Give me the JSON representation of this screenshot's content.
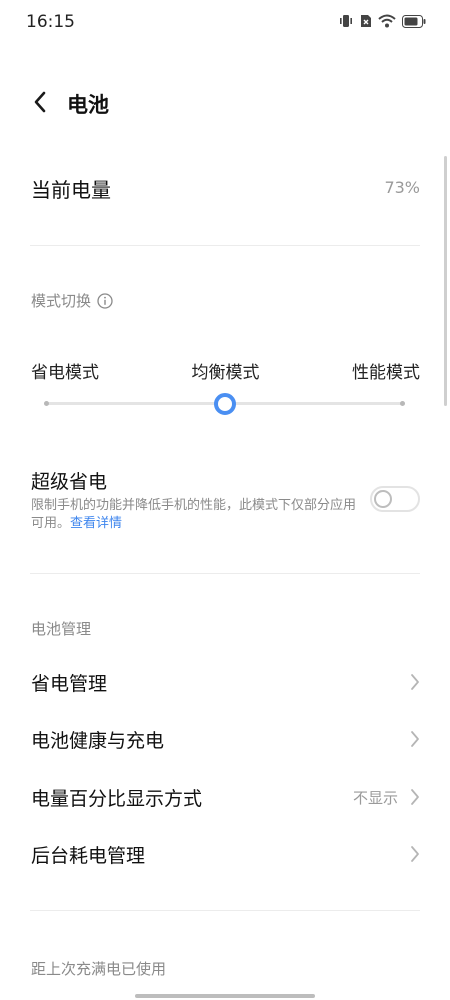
{
  "status_bar": {
    "time": "16:15",
    "icons": [
      "vibrate-icon",
      "no-sim-icon",
      "wifi-icon",
      "battery-icon"
    ]
  },
  "header": {
    "title": "电池",
    "back_icon": "back-arrow-icon"
  },
  "current_level": {
    "label": "当前电量",
    "value": "73%"
  },
  "mode_switch": {
    "section_label": "模式切换",
    "info_icon": "info-icon",
    "options": [
      "省电模式",
      "均衡模式",
      "性能模式"
    ],
    "selected_index": 1,
    "accent_color": "#4a8ff2"
  },
  "super_saver": {
    "title": "超级省电",
    "description": "限制手机的功能并降低手机的性能，此模式下仅部分应用可用。",
    "link_text": "查看详情",
    "enabled": false,
    "link_color": "#3f86ee"
  },
  "battery_management": {
    "section_label": "电池管理",
    "items": [
      {
        "label": "省电管理",
        "value": ""
      },
      {
        "label": "电池健康与充电",
        "value": ""
      },
      {
        "label": "电量百分比显示方式",
        "value": "不显示"
      },
      {
        "label": "后台耗电管理",
        "value": ""
      }
    ]
  },
  "usage": {
    "section_label": "距上次充满电已使用"
  }
}
